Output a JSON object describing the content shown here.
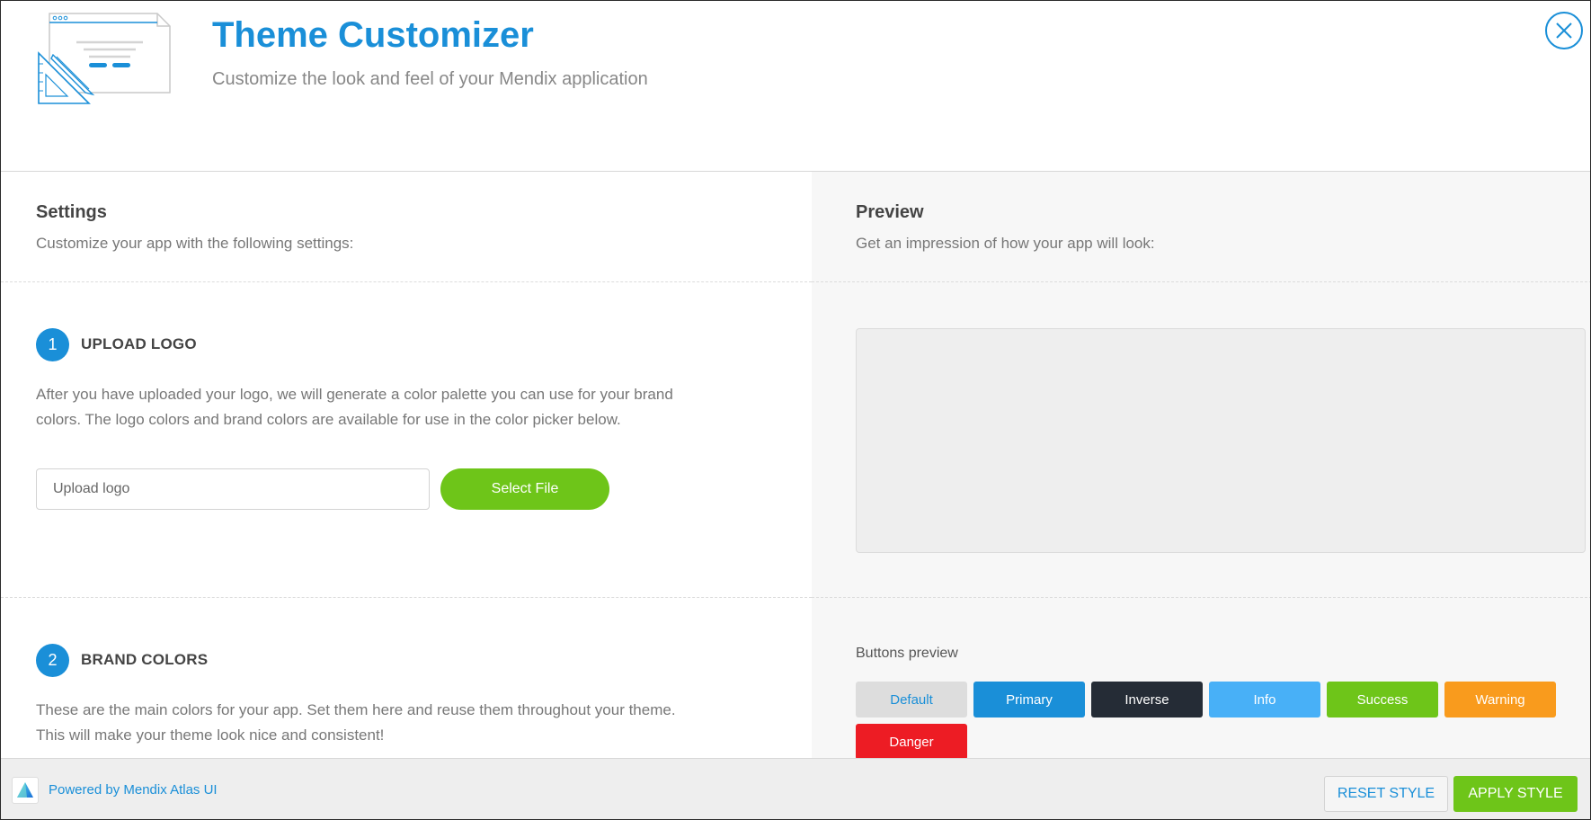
{
  "header": {
    "title": "Theme Customizer",
    "subtitle": "Customize the look and feel of your Mendix application",
    "illustration_icon": "browser-window-ruler-pencil-icon",
    "close_icon": "close-icon"
  },
  "settings": {
    "title": "Settings",
    "subtitle": "Customize your app with the following settings:",
    "steps": [
      {
        "number": "1",
        "title": "UPLOAD LOGO",
        "text": "After you have uploaded your logo, we will generate a color palette you can use for your brand colors. The logo colors and brand colors are available for use in the color picker below."
      },
      {
        "number": "2",
        "title": "BRAND COLORS",
        "text": "These are the main colors for your app. Set them here and reuse them throughout your theme. This will make your theme look nice and consistent!"
      }
    ],
    "upload": {
      "placeholder": "Upload logo",
      "button_label": "Select File"
    }
  },
  "preview": {
    "title": "Preview",
    "subtitle": "Get an impression of how your app will look:",
    "buttons_label": "Buttons preview",
    "buttons": [
      {
        "label": "Default"
      },
      {
        "label": "Primary"
      },
      {
        "label": "Inverse"
      },
      {
        "label": "Info"
      },
      {
        "label": "Success"
      },
      {
        "label": "Warning"
      },
      {
        "label": "Danger"
      }
    ]
  },
  "footer": {
    "powered_by": "Powered by Mendix Atlas UI",
    "logo_icon": "atlas-triangle-icon",
    "reset_label": "RESET STYLE",
    "apply_label": "APPLY STYLE"
  },
  "colors": {
    "brand_primary": "#1a8fd8",
    "success": "#6ec519",
    "inverse": "#252c36",
    "info": "#48b0f7",
    "warning": "#f99b1d",
    "danger": "#ed1c24",
    "default": "#dddddd"
  }
}
